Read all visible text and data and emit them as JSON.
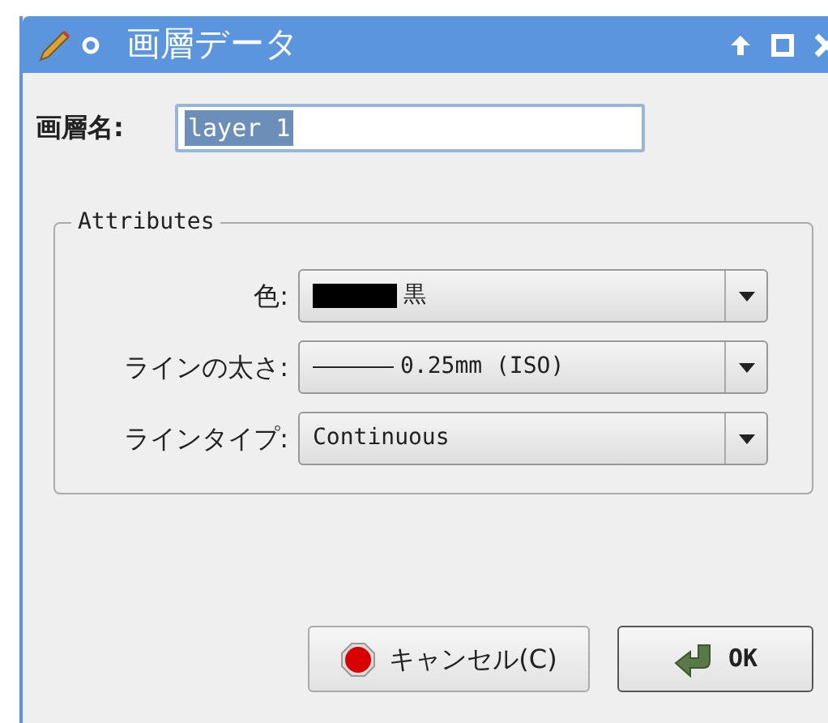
{
  "window": {
    "title": "画層データ"
  },
  "layer_name": {
    "label": "画層名:",
    "value": "layer 1",
    "selected": true
  },
  "attributes": {
    "title": "Attributes",
    "rows": [
      {
        "kind": "color",
        "label": "色:",
        "value": "黒",
        "color": "#000000"
      },
      {
        "kind": "linewidth",
        "label": "ラインの太さ:",
        "value": "0.25mm (ISO)"
      },
      {
        "kind": "text",
        "label": "ラインタイプ:",
        "value": "Continuous"
      }
    ]
  },
  "buttons": [
    {
      "kind": "cancel",
      "label": "キャンセル(C)"
    },
    {
      "kind": "ok",
      "label": "OK"
    }
  ]
}
